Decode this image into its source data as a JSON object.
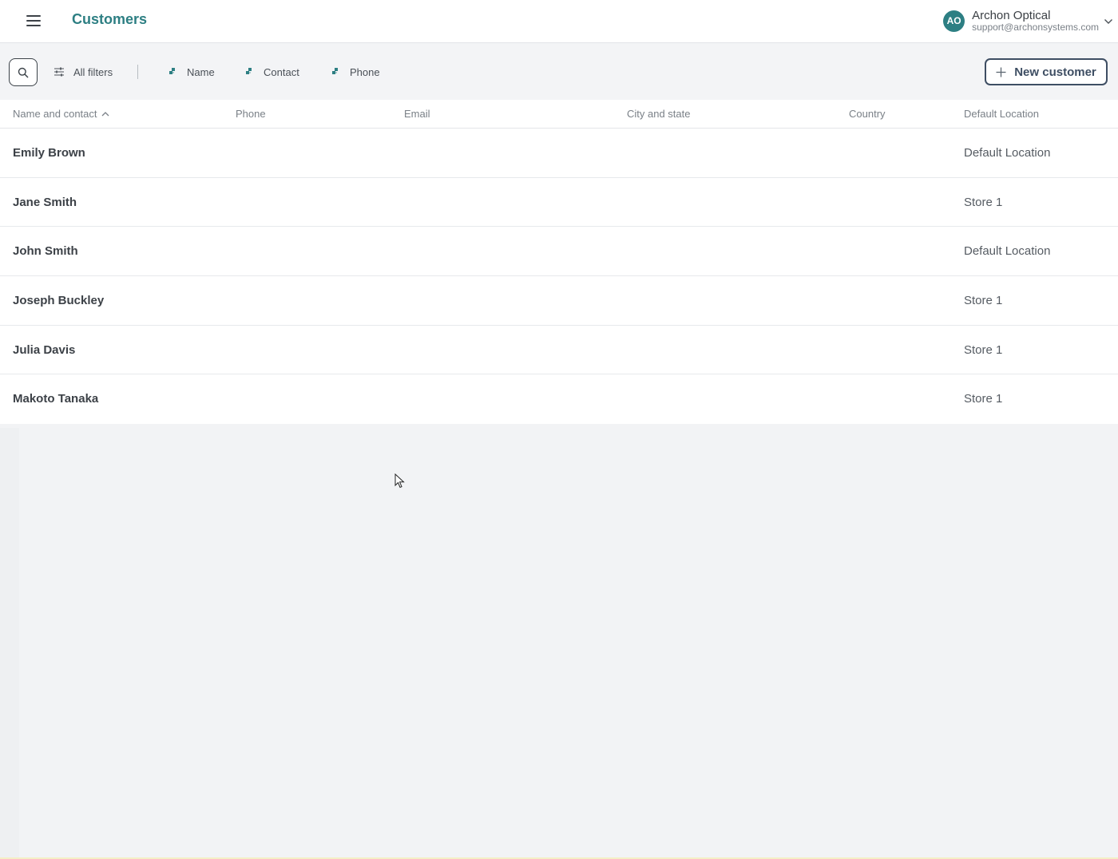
{
  "header": {
    "title": "Customers",
    "account": {
      "initials": "AO",
      "name": "Archon Optical",
      "email": "support@archonsystems.com"
    }
  },
  "filters": {
    "all_filters_label": "All filters",
    "chips": [
      "Name",
      "Contact",
      "Phone"
    ],
    "new_customer_label": "New customer"
  },
  "table": {
    "columns": [
      "Name and contact",
      "Phone",
      "Email",
      "City and state",
      "Country",
      "Default Location"
    ],
    "sorted_column": "Name and contact",
    "sort_direction": "ascending",
    "rows": [
      {
        "name": "Emily Brown",
        "location": "Default Location"
      },
      {
        "name": "Jane Smith",
        "location": "Store 1"
      },
      {
        "name": "John Smith",
        "location": "Default Location"
      },
      {
        "name": "Joseph Buckley",
        "location": "Store 1"
      },
      {
        "name": "Julia Davis",
        "location": "Store 1"
      },
      {
        "name": "Makoto Tanaka",
        "location": "Store 1"
      }
    ]
  },
  "colors": {
    "accent": "#2d7f83",
    "button_border": "#3e4e63",
    "background": "#f2f3f5"
  },
  "icons": {
    "menu": "hamburger-menu-icon",
    "search": "search-icon",
    "filters": "sliders-icon",
    "chip": "puzzle-piece-icon",
    "add": "plus-icon",
    "sort": "chevron-up-icon",
    "account_menu": "chevron-down-icon"
  }
}
